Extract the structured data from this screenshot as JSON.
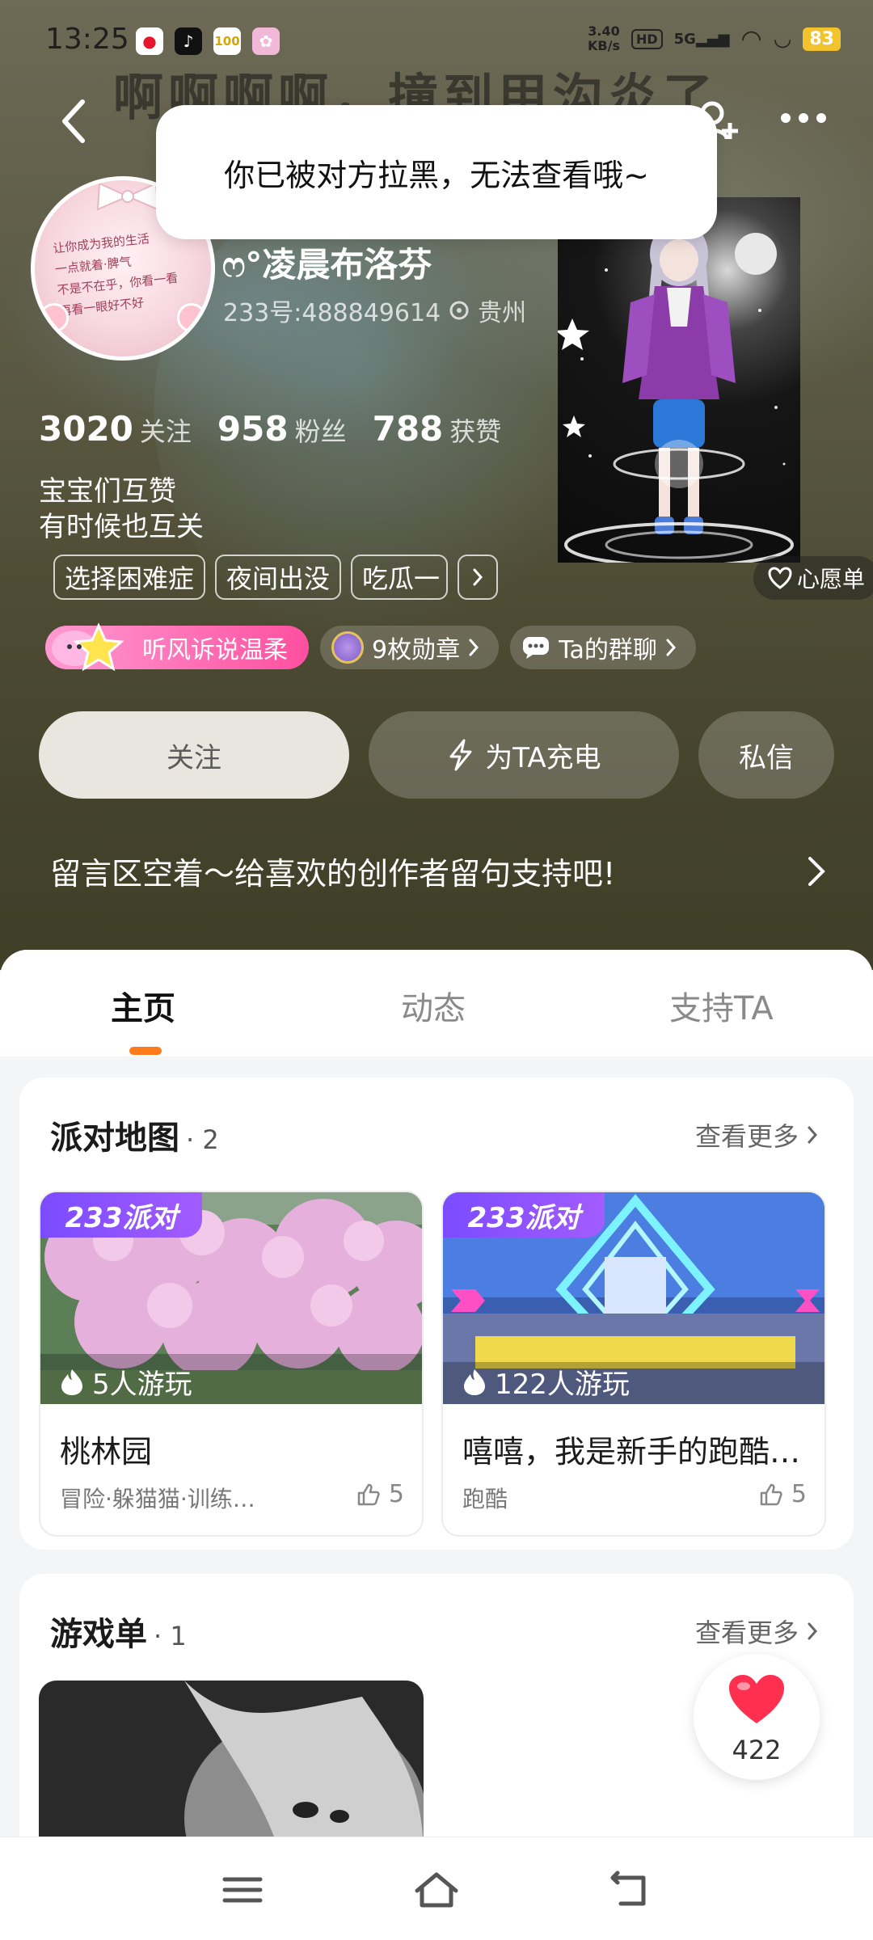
{
  "status_bar": {
    "time": "13:25",
    "speed": "3.40",
    "speed_unit": "KB/s",
    "hd": "HD",
    "network": "5G",
    "battery": "83",
    "app_icons": [
      "weibo-icon",
      "tiktok-icon",
      "100-icon",
      "game-icon"
    ]
  },
  "hero": {
    "background_text": "啊啊啊啊，撞到甲沟炎了"
  },
  "toast": {
    "message": "你已被对方拉黑，无法查看哦~"
  },
  "profile": {
    "name": "ෆ°凌晨布洛芬",
    "id": "233号:488849614",
    "location": "贵州",
    "avatar_text": [
      "让你成为我的生活",
      "一点就着·脾气",
      "不是不在乎，你看一看",
      "再看一眼好不好"
    ],
    "stats": [
      {
        "value": "3020",
        "label": "关注"
      },
      {
        "value": "958",
        "label": "粉丝"
      },
      {
        "value": "788",
        "label": "获赞"
      }
    ],
    "bio": [
      "宝宝们互赞",
      "有时候也互关"
    ],
    "tags": [
      "选择困难症",
      "夜间出没",
      "吃瓜一"
    ],
    "wishlist_label": "心愿单",
    "title_badge": "听风诉说温柔",
    "medals_label": "9枚勋章",
    "group_label": "Ta的群聊"
  },
  "actions": {
    "follow": "关注",
    "charge": "为TA充电",
    "message": "私信"
  },
  "comment_prompt": "留言区空着～给喜欢的创作者留句支持吧!",
  "tabs": [
    {
      "label": "主页",
      "active": true
    },
    {
      "label": "动态",
      "active": false
    },
    {
      "label": "支持TA",
      "active": false
    }
  ],
  "party_map": {
    "title": "派对地图",
    "count": "· 2",
    "more": "查看更多",
    "items": [
      {
        "tag": "233派对",
        "players": "5人游玩",
        "name": "桃林园",
        "sub": "冒险·躲猫猫·训练…",
        "likes": "5"
      },
      {
        "tag": "233派对",
        "players": "122人游玩",
        "name": "嘻嘻，我是新手的跑酷…",
        "sub": "跑酷",
        "likes": "5"
      }
    ]
  },
  "game_list": {
    "title": "游戏单",
    "count": "· 1",
    "more": "查看更多"
  },
  "like_fab": {
    "count": "422"
  },
  "colors": {
    "accent": "#ff7a1a",
    "badge_pink": "#ff4fa0",
    "party_tag": "#7b4bff",
    "heart": "#ff2f4f"
  }
}
